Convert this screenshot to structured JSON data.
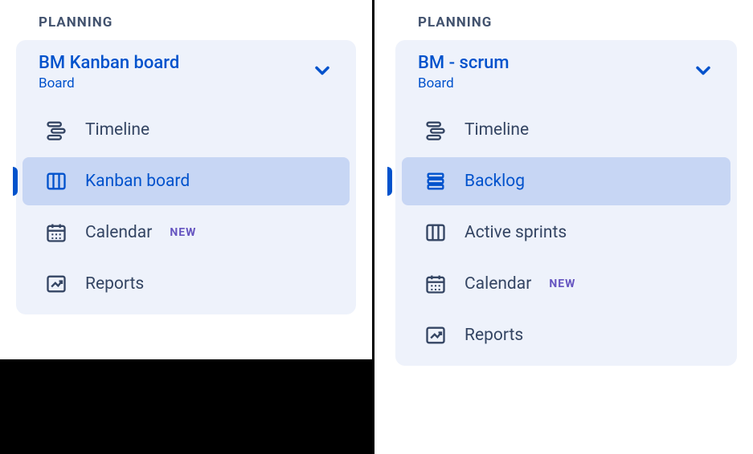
{
  "left": {
    "section_label": "PLANNING",
    "board_title": "BM Kanban board",
    "board_sub": "Board",
    "items": [
      {
        "icon": "timeline",
        "label": "Timeline",
        "active": false,
        "badge": ""
      },
      {
        "icon": "board",
        "label": "Kanban board",
        "active": true,
        "badge": ""
      },
      {
        "icon": "calendar",
        "label": "Calendar",
        "active": false,
        "badge": "NEW"
      },
      {
        "icon": "reports",
        "label": "Reports",
        "active": false,
        "badge": ""
      }
    ]
  },
  "right": {
    "section_label": "PLANNING",
    "board_title": "BM - scrum",
    "board_sub": "Board",
    "items": [
      {
        "icon": "timeline",
        "label": "Timeline",
        "active": false,
        "badge": ""
      },
      {
        "icon": "backlog",
        "label": "Backlog",
        "active": true,
        "badge": ""
      },
      {
        "icon": "board",
        "label": "Active sprints",
        "active": false,
        "badge": ""
      },
      {
        "icon": "calendar",
        "label": "Calendar",
        "active": false,
        "badge": "NEW"
      },
      {
        "icon": "reports",
        "label": "Reports",
        "active": false,
        "badge": ""
      }
    ]
  }
}
